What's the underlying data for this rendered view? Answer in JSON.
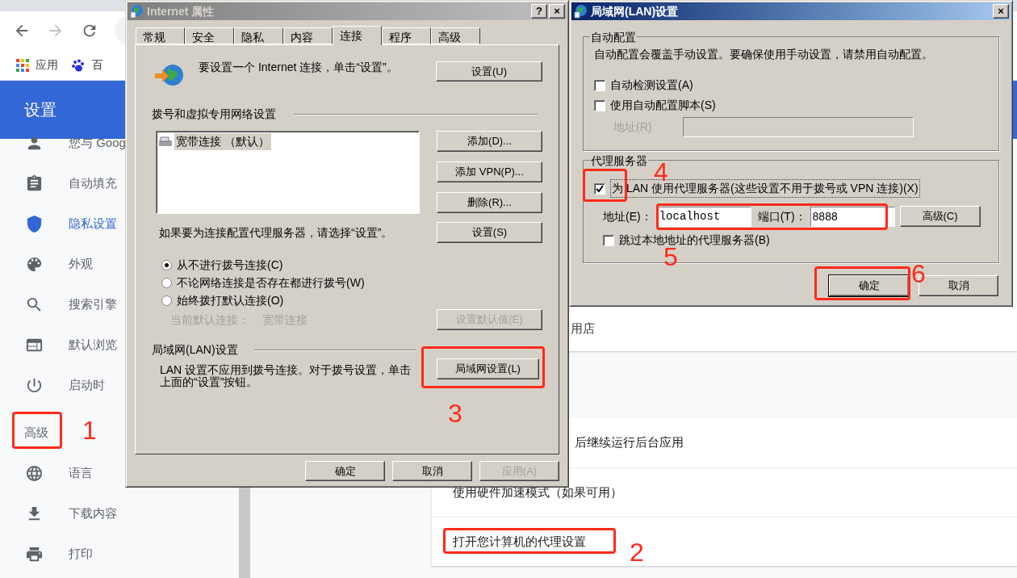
{
  "browser": {
    "bookmarks": [
      {
        "label": "应用"
      },
      {
        "label": "百"
      }
    ],
    "header_title": "设置",
    "sidebar": [
      {
        "kind": "item",
        "label": "您与 Goog",
        "selected": false
      },
      {
        "kind": "item",
        "label": "自动填充",
        "selected": false
      },
      {
        "kind": "item",
        "label": "隐私设置",
        "selected": true
      },
      {
        "kind": "item",
        "label": "外观",
        "selected": false
      },
      {
        "kind": "item",
        "label": "搜索引擎",
        "selected": false
      },
      {
        "kind": "item",
        "label": "默认浏览",
        "selected": false
      },
      {
        "kind": "item",
        "label": "启动时",
        "selected": false
      },
      {
        "kind": "section",
        "label": "高级",
        "selected": false
      },
      {
        "kind": "item",
        "label": "语言",
        "selected": false
      },
      {
        "kind": "item",
        "label": "下载内容",
        "selected": false
      },
      {
        "kind": "item",
        "label": "打印",
        "selected": false
      }
    ],
    "top_card": "用店",
    "rows": [
      "后继续运行后台应用",
      "使用硬件加速模式（如果可用）",
      "打开您计算机的代理设置"
    ]
  },
  "internet_properties": {
    "title": "Internet 属性",
    "help_button": "?",
    "close_button": "×",
    "tabs": [
      {
        "label": "常规",
        "selected": false
      },
      {
        "label": "安全",
        "selected": false
      },
      {
        "label": "隐私",
        "selected": false
      },
      {
        "label": "内容",
        "selected": false
      },
      {
        "label": "连接",
        "selected": true
      },
      {
        "label": "程序",
        "selected": false
      },
      {
        "label": "高级",
        "selected": false
      }
    ],
    "setup_text": "要设置一个 Internet 连接，单击“设置”。",
    "setup_button": "设置(U)",
    "dialup_group": "拨号和虚拟专用网络设置",
    "connections": [
      {
        "label": "宽带连接 （默认）",
        "selected": true
      }
    ],
    "connection_buttons": [
      "添加(D)...",
      "添加 VPN(P)...",
      "删除(R)..."
    ],
    "proxy_text": "如果要为连接配置代理服务器，请选择“设置”。",
    "proxy_button": "设置(S)",
    "dial_options": [
      {
        "label": "从不进行拨号连接(C)",
        "selected": true
      },
      {
        "label": "不论网络连接是否存在都进行拨号(W)",
        "selected": false
      },
      {
        "label": "始终拨打默认连接(O)",
        "selected": false
      }
    ],
    "current_default_label": "当前默认连接：",
    "current_default_value": "宽带连接",
    "set_default_button": {
      "label": "设置默认值(E)",
      "disabled": true
    },
    "lan_group": "局域网(LAN)设置",
    "lan_text": "LAN 设置不应用到拨号连接。对于拨号设置，单击上面的“设置”按钮。",
    "lan_button": "局域网设置(L)",
    "footer_buttons": [
      {
        "label": "确定",
        "disabled": false
      },
      {
        "label": "取消",
        "disabled": false
      },
      {
        "label": "应用(A)",
        "disabled": true
      }
    ]
  },
  "lan_settings": {
    "title": "局域网(LAN)设置",
    "close_button": "×",
    "auto_group": {
      "title": "自动配置",
      "description": "自动配置会覆盖手动设置。要确保使用手动设置，请禁用自动配置。",
      "options": [
        {
          "label": "自动检测设置(A)",
          "checked": false
        },
        {
          "label": "使用自动配置脚本(S)",
          "checked": false
        }
      ],
      "address": {
        "label": "地址(R)",
        "disabled": true
      }
    },
    "proxy_group": {
      "title": "代理服务器",
      "use_proxy": {
        "label": "为 LAN 使用代理服务器(这些设置不用于拨号或 VPN 连接)(X)",
        "checked": true
      },
      "address": {
        "label": "地址(E)：",
        "value": "localhost"
      },
      "port": {
        "label": "端口(T)：",
        "value": "8888"
      },
      "advanced_button": "高级(C)",
      "bypass": {
        "label": "跳过本地地址的代理服务器(B)",
        "checked": false
      }
    },
    "buttons": [
      {
        "label": "确定",
        "default": true
      },
      {
        "label": "取消",
        "default": false
      }
    ]
  },
  "annotations": [
    {
      "label": "1"
    },
    {
      "label": "2"
    },
    {
      "label": "3"
    },
    {
      "label": "4"
    },
    {
      "label": "5"
    },
    {
      "label": "6"
    }
  ]
}
